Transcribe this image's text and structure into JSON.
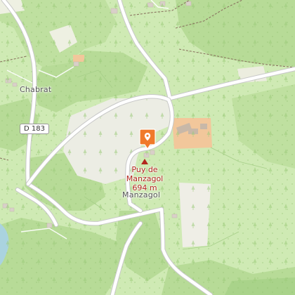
{
  "map": {
    "places": {
      "chabrat": "Chabrat",
      "manzagol": "Manzagol"
    },
    "road_ref": "D 183",
    "peak": {
      "name_line1": "Puy de",
      "name_line2": "Manzagol",
      "elevation": "694 m"
    },
    "marker_icon": "location-pin-icon",
    "colors": {
      "background": "#cfeab4",
      "forest": "#b7db97",
      "clearing": "#ecede4",
      "farmyard": "#f2c79b",
      "water": "#aad3df",
      "road": "#ffffff",
      "road_casing": "#c8c8c8",
      "footpath": "#8a7560",
      "marker": "#f07a2a",
      "peak_label": "#b3261e"
    }
  }
}
